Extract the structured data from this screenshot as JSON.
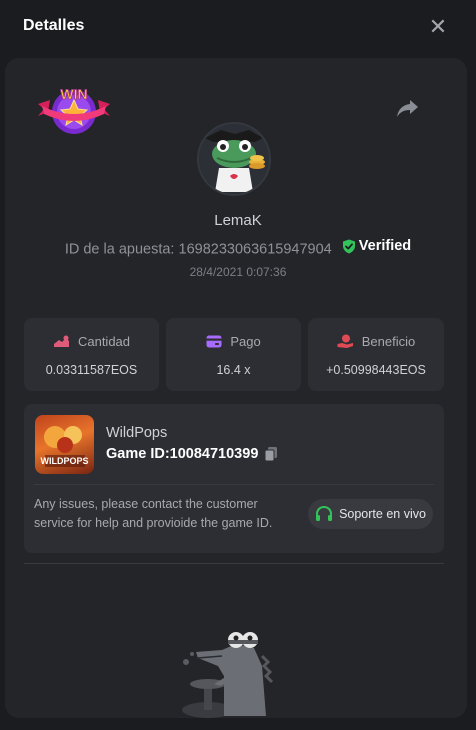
{
  "header": {
    "title": "Detalles",
    "close_label": "✕"
  },
  "player": {
    "username": "LemaK"
  },
  "bet": {
    "id_label": "ID de la apuesta:",
    "id_value": "1698233063615947904",
    "verified_label": "Verified",
    "datetime": "28/4/2021 0:07:36"
  },
  "badge": {
    "text": "WIN"
  },
  "stats": [
    {
      "label": "Cantidad",
      "value": "0.03311587EOS",
      "icon": "coin-icon",
      "color": "#e05a7a"
    },
    {
      "label": "Pago",
      "value": "16.4 x",
      "icon": "card-icon",
      "color": "#a86bff"
    },
    {
      "label": "Beneficio",
      "value": "+0.50998443EOS",
      "icon": "hand-coin-icon",
      "color": "#e04a55"
    }
  ],
  "game": {
    "name": "WildPops",
    "id_label": "Game ID:",
    "id_value": "10084710399",
    "thumb_text": "WILDPOPS"
  },
  "support": {
    "message": "Any issues, please contact the customer service for help and provioide the game ID.",
    "button_label": "Soporte en vivo"
  },
  "colors": {
    "accent_green": "#32c35a",
    "panel": "#242529",
    "card": "#2d2e33"
  }
}
